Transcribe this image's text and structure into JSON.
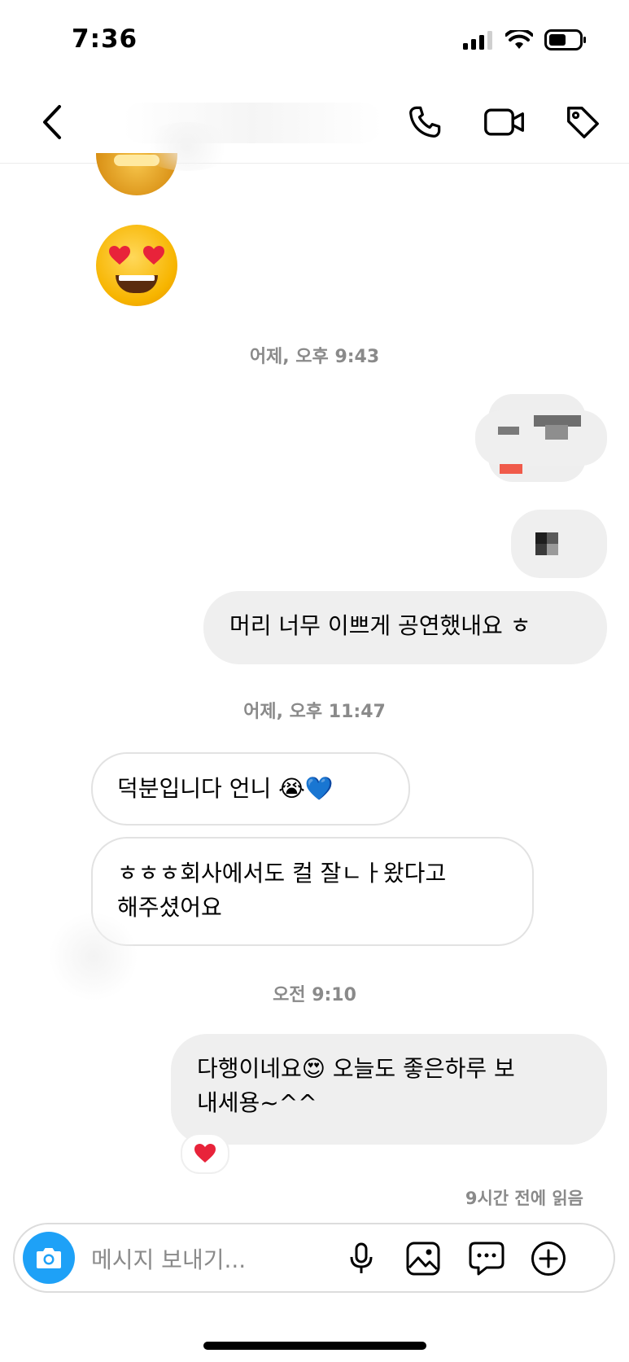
{
  "status_bar": {
    "time": "7:36"
  },
  "header": {
    "back_icon": "chevron-left-icon",
    "call_icon": "phone-icon",
    "video_icon": "video-camera-icon",
    "tag_icon": "tag-icon"
  },
  "messages": {
    "timestamp_1": "어제, 오후 9:43",
    "outgoing_1": "머리 너무 이쁘게 공연했내요 ㅎ",
    "timestamp_2": "어제, 오후 11:47",
    "incoming_1": "덕분입니다 언니 😭💙",
    "incoming_2_line1": "ㅎㅎㅎ회사에서도 컬 잘ㄴㅏ왔다고",
    "incoming_2_line2": "해주셨어요",
    "timestamp_3": "오전 9:10",
    "outgoing_2_line1": "다행이네요😍 오늘도 좋은하루 보",
    "outgoing_2_line2": "내세용~^^",
    "reaction": "❤️",
    "read_receipt": "9시간 전에 읽음"
  },
  "composer": {
    "placeholder": "메시지 보내기...",
    "camera_icon": "camera-icon",
    "mic_icon": "microphone-icon",
    "gallery_icon": "image-icon",
    "sticker_icon": "chat-bubble-icon",
    "plus_icon": "plus-circle-icon"
  },
  "colors": {
    "camera_blue": "#1ea1f7",
    "bubble_gray": "#efefef",
    "timestamp_gray": "#8a8a8a"
  }
}
